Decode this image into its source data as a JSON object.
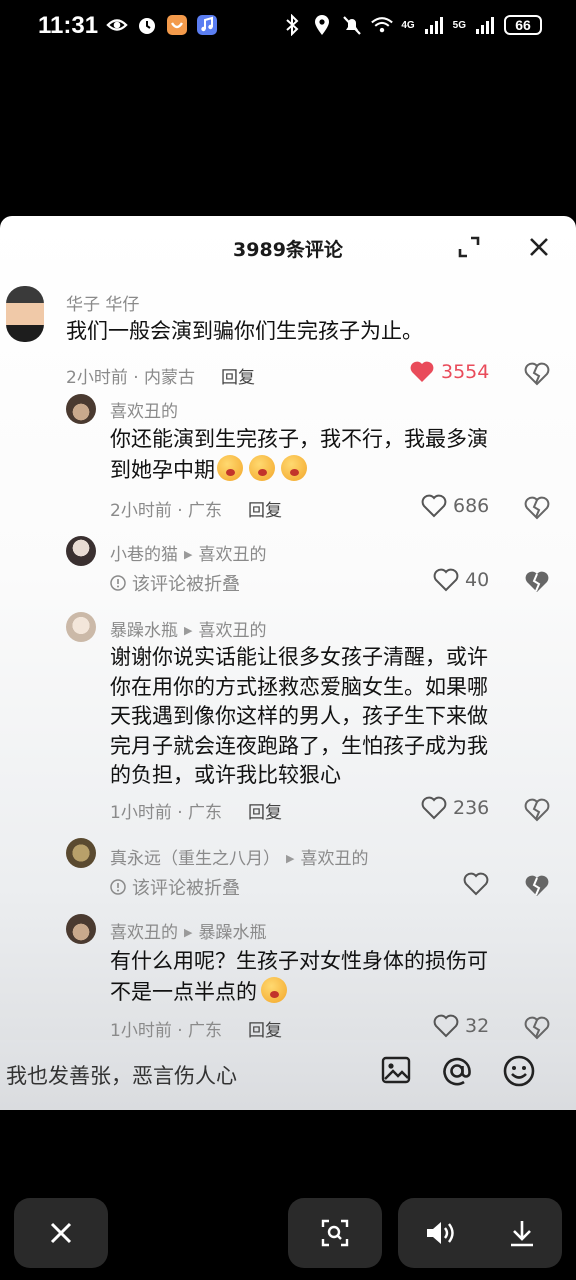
{
  "status_bar": {
    "time": "11:31",
    "battery": "66",
    "net1": "4G",
    "net2": "5G"
  },
  "sheet": {
    "title": "3989条评论"
  },
  "comments": [
    {
      "name": "华子 华仔",
      "text_lines": [
        "我们一般会演到骗你们生完孩子为止。"
      ],
      "time_loc": "2小时前 · 内蒙古",
      "reply": "回复",
      "likes": "3554"
    },
    {
      "name": "喜欢丑的",
      "text_lines": [
        "你还能演到生完孩子，我不行，我最多演",
        "到她孕中期"
      ],
      "time_loc": "2小时前 · 广东",
      "reply": "回复",
      "likes": "686"
    },
    {
      "name": "小巷的猫",
      "reply_to": "喜欢丑的",
      "folded": "该评论被折叠",
      "likes": "40"
    },
    {
      "name": "暴躁水瓶",
      "reply_to": "喜欢丑的",
      "text_lines": [
        "谢谢你说实话能让很多女孩子清醒，或许",
        "你在用你的方式拯救恋爱脑女生。如果哪",
        "天我遇到像你这样的男人，孩子生下来做",
        "完月子就会连夜跑路了，生怕孩子成为我",
        "的负担，或许我比较狠心"
      ],
      "time_loc": "1小时前 · 广东",
      "reply": "回复",
      "likes": "236"
    },
    {
      "name": "真永远（重生之八月）",
      "reply_to": "喜欢丑的",
      "folded": "该评论被折叠",
      "likes": ""
    },
    {
      "name": "喜欢丑的",
      "reply_to": "暴躁水瓶",
      "text_lines": [
        "有什么用呢？生孩子对女性身体的损伤可",
        "不是一点半点的"
      ],
      "time_loc": "1小时前 · 广东",
      "reply": "回复",
      "likes": "32"
    }
  ],
  "input": {
    "placeholder": "我也发善张，恶言伤人心"
  },
  "icons": {
    "expand": "expand-icon",
    "close": "close-icon",
    "heart": "heart-icon",
    "broken_heart": "broken-heart-icon",
    "image": "image-icon",
    "at": "at-icon",
    "emoji": "emoji-icon",
    "search_image": "image-search-icon",
    "volume": "volume-icon",
    "download": "download-icon"
  },
  "colors": {
    "like_active": "#e94b5a",
    "sheet_bg": "#ffffff",
    "page_bg": "#000000"
  }
}
